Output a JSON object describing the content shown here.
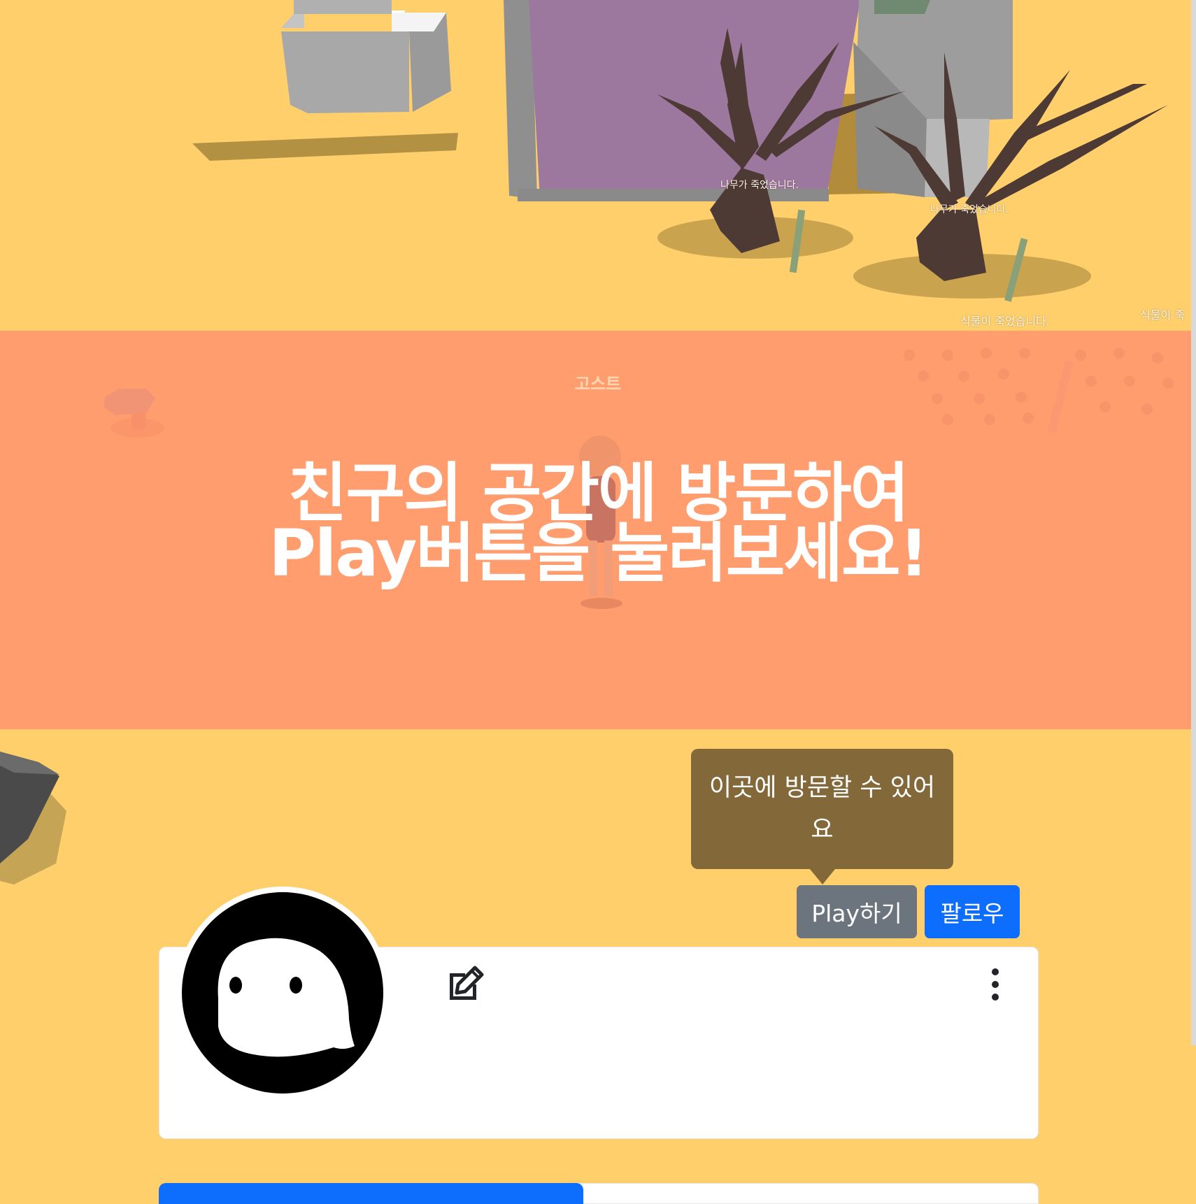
{
  "game": {
    "labels": {
      "tree_dead_1": "나무가 죽었습니다.",
      "tree_dead_2": "나무가 죽었습니다.",
      "plant_dead_1": "식물이 죽었습니다.",
      "plant_dead_2": "식물이 죽"
    },
    "colors": {
      "ground": "#ffcf6b",
      "overlay": "#ff966e",
      "wall_purple": "#9c779e",
      "wall_gray": "#9e9e9e",
      "tree": "#4a3530"
    }
  },
  "overlay": {
    "ghost_name": "고스트",
    "title_line1": "친구의 공간에 방문하여",
    "title_line2": "Play버튼을 눌러보세요!"
  },
  "tooltip": {
    "text": "이곳에 방문할 수 있어요"
  },
  "actions": {
    "play_label": "Play하기",
    "follow_label": "팔로우",
    "play_color": "#6c757d",
    "follow_color": "#0d6efd"
  },
  "profile": {
    "avatar_icon": "ghost-avatar-icon",
    "edit_icon": "edit-icon",
    "menu_icon": "kebab-menu-icon"
  }
}
